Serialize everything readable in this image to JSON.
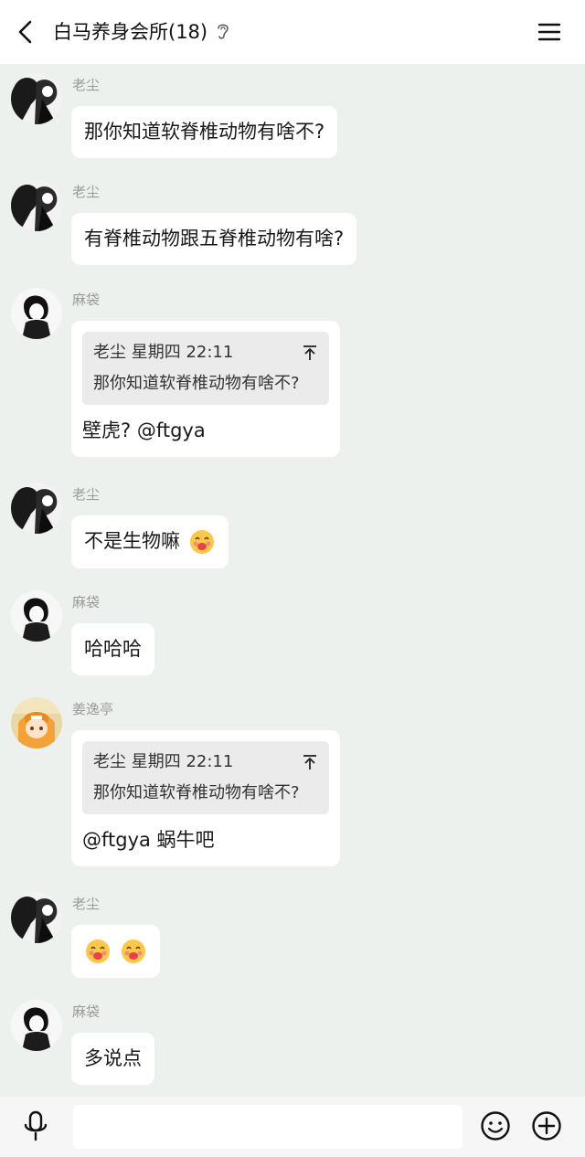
{
  "header": {
    "title": "白马养身会所(18)",
    "back_icon": "back-chevron-icon",
    "ear_icon": "ear-icon",
    "menu_icon": "hamburger-menu-icon"
  },
  "messages": [
    {
      "sender": "老尘",
      "avatar": "bw-manga-couple",
      "text": "那你知道软脊椎动物有啥不?"
    },
    {
      "sender": "老尘",
      "avatar": "bw-manga-couple",
      "text": "有脊椎动物跟五脊椎动物有啥?"
    },
    {
      "sender": "麻袋",
      "avatar": "bw-manga-girl",
      "quote": {
        "head": "老尘 星期四 22:11",
        "body": "那你知道软脊椎动物有啥不?"
      },
      "text": "壁虎? @ftgya"
    },
    {
      "sender": "老尘",
      "avatar": "bw-manga-couple",
      "text": "不是生物嘛",
      "emoji": 1
    },
    {
      "sender": "麻袋",
      "avatar": "bw-manga-girl",
      "text": "哈哈哈"
    },
    {
      "sender": "姜逸亭",
      "avatar": "color-anime-girl",
      "quote": {
        "head": "老尘 星期四 22:11",
        "body": "那你知道软脊椎动物有啥不?"
      },
      "text": "@ftgya 蜗牛吧"
    },
    {
      "sender": "老尘",
      "avatar": "bw-manga-couple",
      "text": "",
      "emoji": 2
    },
    {
      "sender": "麻袋",
      "avatar": "bw-manga-girl",
      "text": "多说点"
    }
  ],
  "footer": {
    "input_value": "",
    "mic_icon": "microphone-icon",
    "emoji_icon": "smiley-icon",
    "plus_icon": "plus-circle-icon"
  },
  "colors": {
    "chat_bg": "#edf1ed",
    "bubble": "#ffffff",
    "quote_bg": "#ebebeb",
    "sender_text": "#9a9a9a"
  }
}
